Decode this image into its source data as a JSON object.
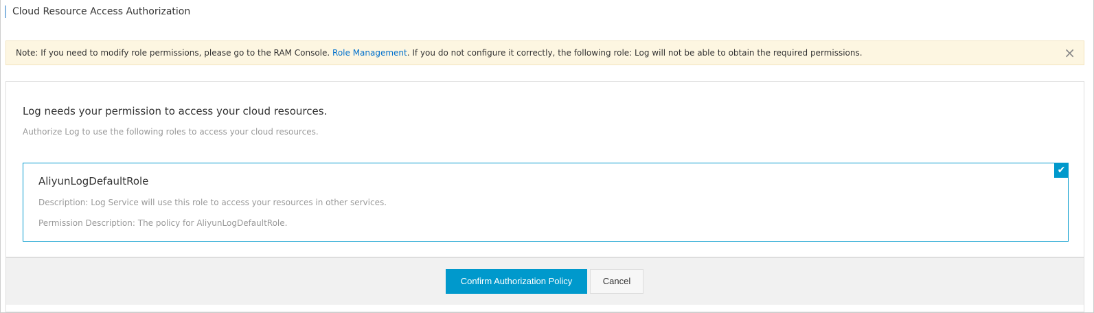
{
  "header": {
    "title": "Cloud Resource Access Authorization"
  },
  "notice": {
    "text_before": "Note: If you need to modify role permissions, please go to the RAM Console. ",
    "link": "Role Management",
    "text_after": ". If you do not configure it correctly, the following role: Log will not be able to obtain the required permissions.",
    "close_icon": "×"
  },
  "panel": {
    "heading": "Log needs your permission to access your cloud resources.",
    "subheading": "Authorize Log to use the following roles to access your cloud resources.",
    "role": {
      "name": "AliyunLogDefaultRole",
      "description": "Description: Log Service will use this role to access your resources in other services.",
      "permission": "Permission Description: The policy for AliyunLogDefaultRole.",
      "checked": true,
      "check_icon": "✔"
    }
  },
  "footer": {
    "confirm_label": "Confirm Authorization Policy",
    "cancel_label": "Cancel"
  },
  "colors": {
    "accent": "#0099cc",
    "link": "#0070cc",
    "notice_bg": "#fdf6e1"
  }
}
